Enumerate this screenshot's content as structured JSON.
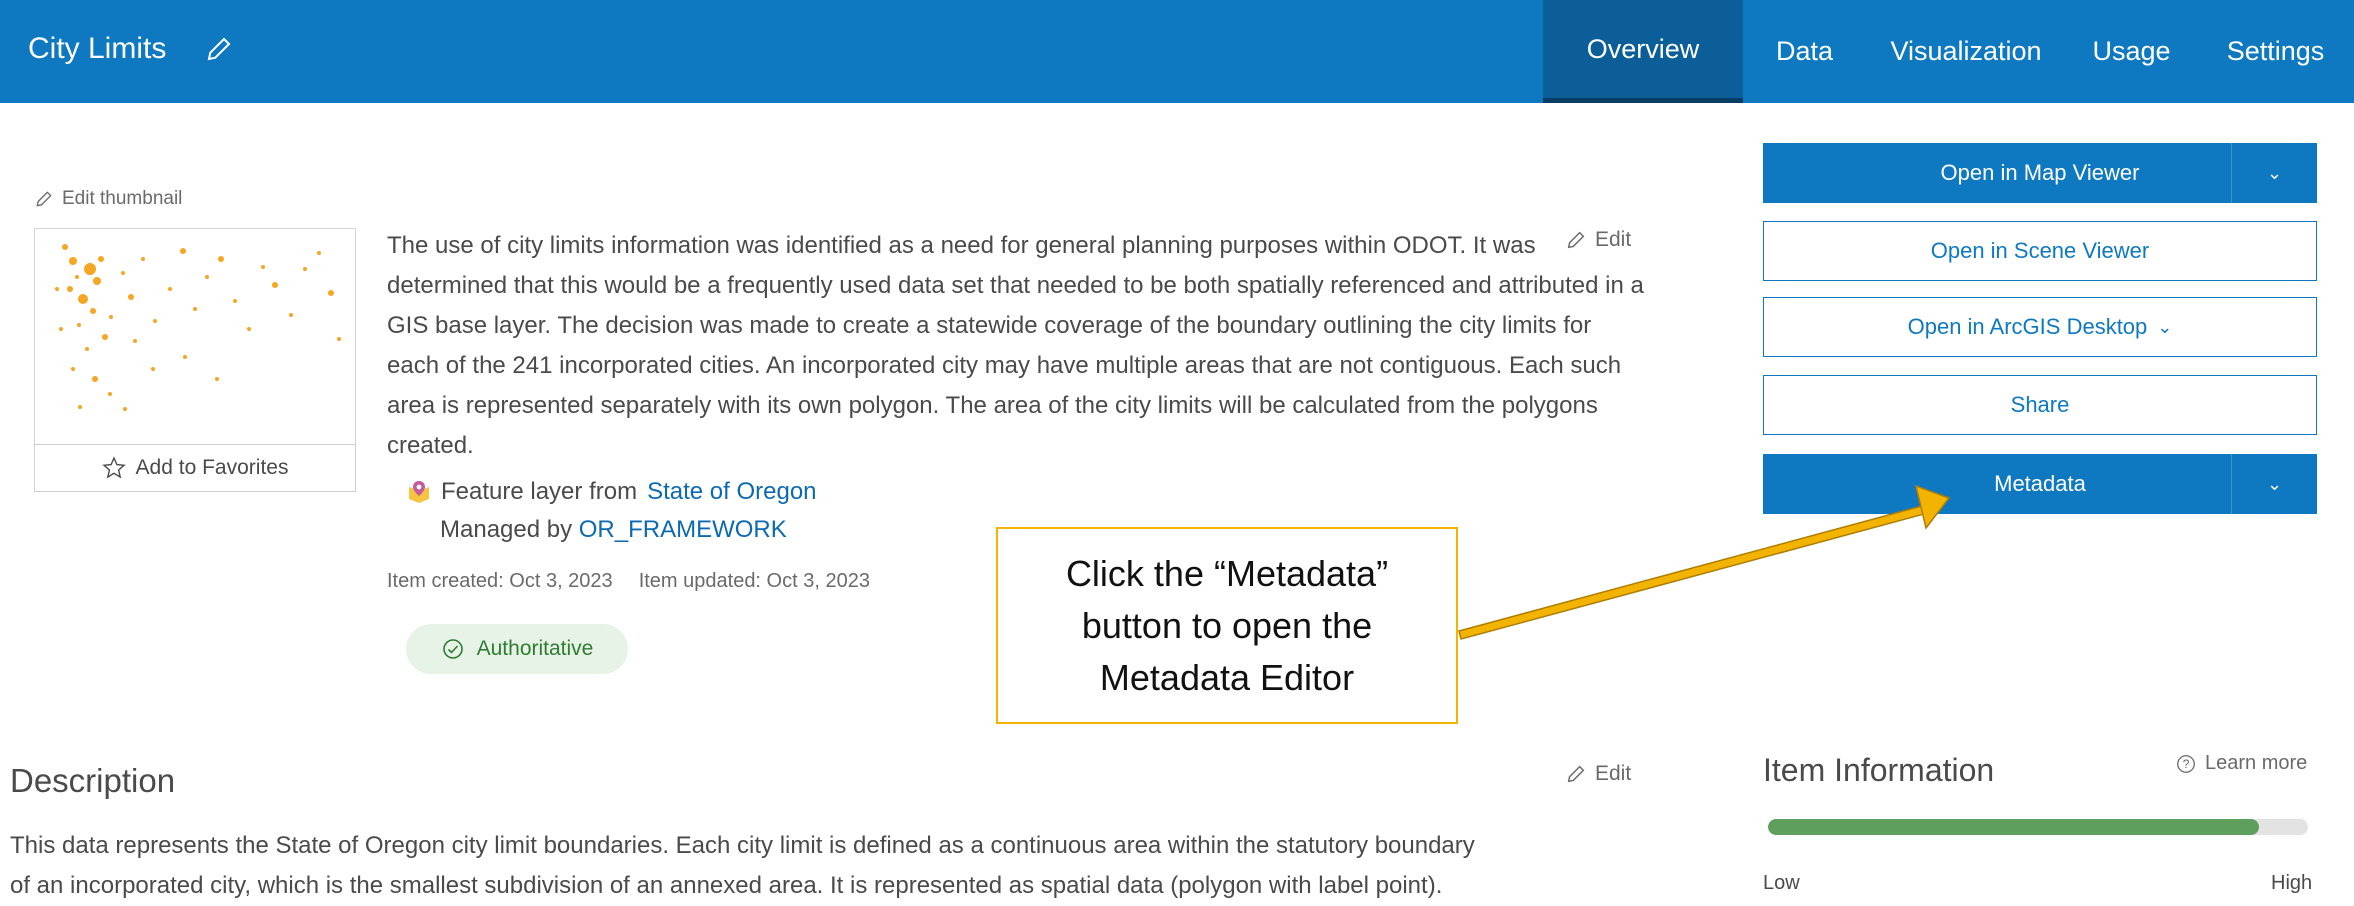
{
  "header": {
    "title": "City Limits",
    "tabs": [
      {
        "label": "Overview",
        "active": true
      },
      {
        "label": "Data",
        "active": false
      },
      {
        "label": "Visualization",
        "active": false
      },
      {
        "label": "Usage",
        "active": false
      },
      {
        "label": "Settings",
        "active": false
      }
    ]
  },
  "thumbnail": {
    "edit_label": "Edit thumbnail",
    "favorites_label": "Add to Favorites"
  },
  "summary": {
    "text": "The use of city limits information was identified as a need for general planning purposes within ODOT. It was determined that this would be a frequently used data set that needed to be both spatially referenced and attributed in a GIS base layer. The decision was made to create a statewide coverage of the boundary outlining the city limits for each of the 241 incorporated cities. An incorporated city may have multiple areas that are not contiguous. Each such area is represented separately with its own polygon. The area of the city limits will be calculated from the polygons created.",
    "edit_label": "Edit"
  },
  "item": {
    "layer_prefix": "Feature layer from",
    "layer_source": "State of Oregon",
    "managed_prefix": "Managed by",
    "managed_by": "OR_FRAMEWORK",
    "created": "Item created: Oct 3, 2023",
    "updated": "Item updated: Oct 3, 2023",
    "badge": "Authoritative"
  },
  "callout": {
    "line1": "Click the “Metadata”",
    "line2": "button to open the",
    "line3": "Metadata Editor",
    "color": "#f2b400"
  },
  "actions": {
    "open_map_viewer": "Open in Map Viewer",
    "open_scene_viewer": "Open in Scene Viewer",
    "open_arcgis_desktop": "Open in ArcGIS Desktop",
    "share": "Share",
    "metadata": "Metadata"
  },
  "description": {
    "title": "Description",
    "edit_label": "Edit",
    "line1": "This data represents the State of Oregon city limit boundaries. Each city limit is defined as a continuous area within the statutory boundary",
    "line2": "of an incorporated city, which is the smallest subdivision of an annexed area. It is represented as spatial data (polygon with label point)."
  },
  "item_information": {
    "title": "Item Information",
    "learn_more": "Learn more",
    "score_fraction": 0.91,
    "low_label": "Low",
    "high_label": "High"
  },
  "colors": {
    "header": "#0e79c1",
    "active_tab": "#0b5e98",
    "link": "#0d6ab0",
    "authoritative": "#2e7d32",
    "meter": "#5e9f5e"
  }
}
